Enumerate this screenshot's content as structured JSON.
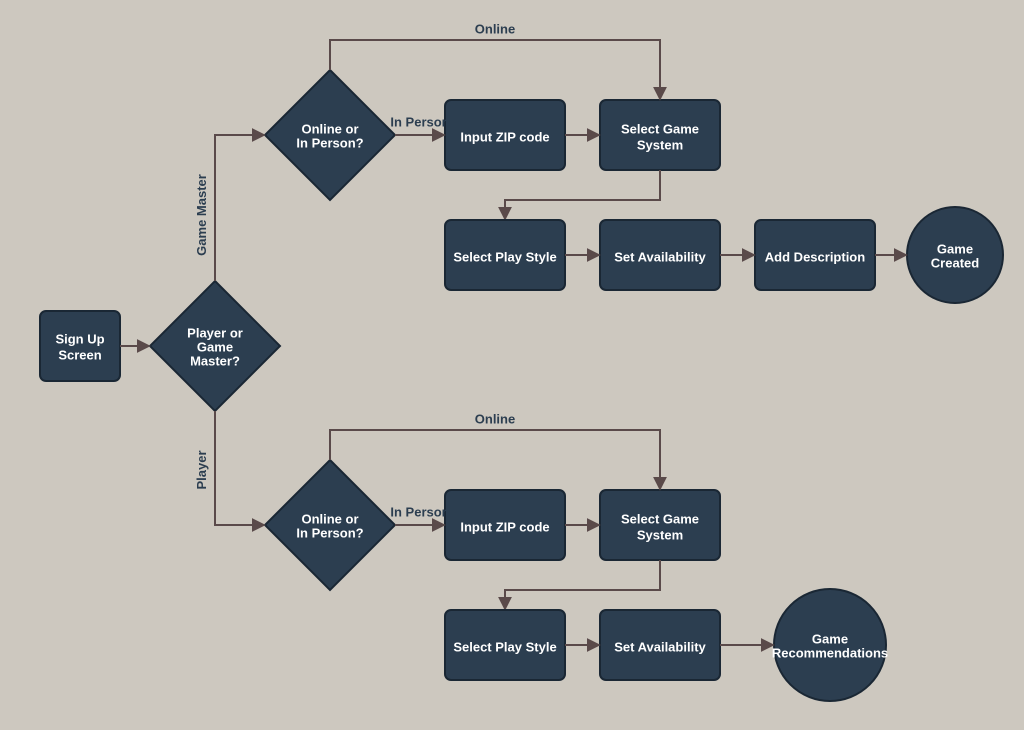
{
  "nodes": {
    "signup": "Sign Up\nScreen",
    "playerOrGm": "Player or\nGame\nMaster?",
    "onlineOrPerson": "Online or\nIn Person?",
    "zip": "Input ZIP code",
    "system": "Select Game\nSystem",
    "playStyle": "Select Play Style",
    "availability": "Set Availability",
    "description": "Add Description",
    "gameCreated": "Game\nCreated",
    "gameRec": "Game\nRecommendations"
  },
  "edges": {
    "gm": "Game Master",
    "player": "Player",
    "online": "Online",
    "inPerson": "In Person"
  }
}
